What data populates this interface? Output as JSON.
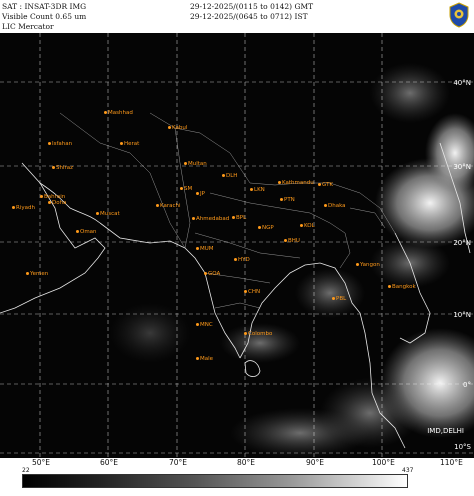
{
  "header": {
    "sat": "SAT : INSAT-3DR IMG",
    "channel": "Visible Count 0.65 um",
    "projection": "LIC Mercator",
    "time_gmt": "29-12-2025/(0115 to 0142) GMT",
    "time_ist": "29-12-2025/(0645 to 0712) IST"
  },
  "credit": "IMD,DELHI",
  "lon_labels": [
    "50°E",
    "60°E",
    "70°E",
    "80°E",
    "90°E",
    "100°E",
    "110°E"
  ],
  "lat_labels": [
    "40°N",
    "30°N",
    "20°N",
    "10°N",
    "0°",
    "10°S"
  ],
  "colorbar": {
    "min": "22",
    "max": "437"
  },
  "cities": [
    {
      "name": "Mashhad"
    },
    {
      "name": "Kabul"
    },
    {
      "name": "Isfahan"
    },
    {
      "name": "Herat"
    },
    {
      "name": "Shiraz"
    },
    {
      "name": "Bahrain"
    },
    {
      "name": "Riyadh"
    },
    {
      "name": "Doha"
    },
    {
      "name": "Muscat"
    },
    {
      "name": "Oman"
    },
    {
      "name": "Yemen"
    },
    {
      "name": "Karachi"
    },
    {
      "name": "Multan"
    },
    {
      "name": "SM"
    },
    {
      "name": "JP"
    },
    {
      "name": "DLH"
    },
    {
      "name": "LKN"
    },
    {
      "name": "Kathmandu"
    },
    {
      "name": "GTK"
    },
    {
      "name": "PTN"
    },
    {
      "name": "KOL"
    },
    {
      "name": "BHU"
    },
    {
      "name": "MUM"
    },
    {
      "name": "HYD"
    },
    {
      "name": "GOA"
    },
    {
      "name": "CHN"
    },
    {
      "name": "MNC"
    },
    {
      "name": "Colombo"
    },
    {
      "name": "Male"
    },
    {
      "name": "Yangon"
    },
    {
      "name": "Bangkok"
    },
    {
      "name": "PBL"
    },
    {
      "name": "Dhaka"
    },
    {
      "name": "Ahmedabad"
    },
    {
      "name": "BPL"
    },
    {
      "name": "NGP"
    }
  ],
  "colors": {
    "city": "#ff9a1a",
    "background": "#050505",
    "grid": "#ffffff"
  }
}
